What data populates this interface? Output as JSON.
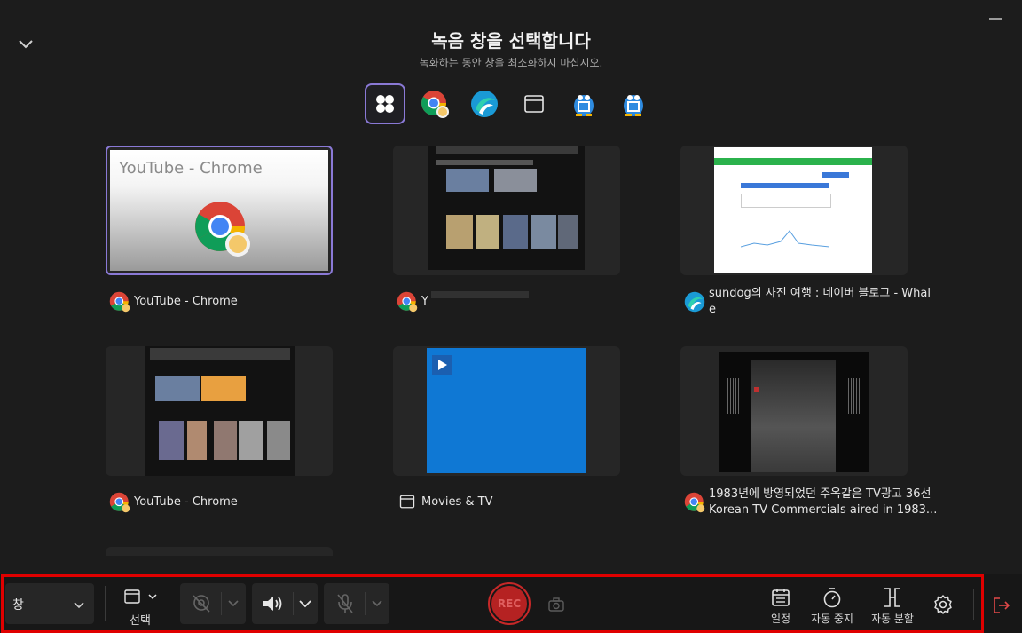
{
  "header": {
    "title": "녹음 창을 선택합니다",
    "subtitle": "녹화하는 동안 창을 최소화하지 마십시오."
  },
  "filters": [
    {
      "name": "all-windows-icon",
      "selected": true
    },
    {
      "name": "chrome-icon",
      "selected": false
    },
    {
      "name": "whale-icon",
      "selected": false
    },
    {
      "name": "window-icon",
      "selected": false
    },
    {
      "name": "capture-app-icon",
      "selected": false
    },
    {
      "name": "capture-app-icon",
      "selected": false
    }
  ],
  "windows": [
    {
      "thumb_title": "YouTube - Chrome",
      "caption": "YouTube - Chrome",
      "icon": "chrome-icon",
      "selected": true
    },
    {
      "caption": "Y",
      "icon": "chrome-icon",
      "selected": false
    },
    {
      "caption": "sundog의 사진 여행 : 네이버 블로그 - Whale",
      "icon": "whale-icon",
      "selected": false
    },
    {
      "caption": "YouTube - Chrome",
      "icon": "chrome-icon",
      "selected": false
    },
    {
      "caption": "Movies & TV",
      "icon": "window-icon",
      "selected": false
    },
    {
      "caption": "1983년에 방영되었던 주옥같은 TV광고 36선 Korean TV Commercials aired in 1983...",
      "icon": "chrome-icon",
      "selected": false
    }
  ],
  "toolbar": {
    "mode_value": "창",
    "select_label": "선택",
    "rec_label": "REC",
    "schedule_label": "일정",
    "auto_stop_label": "자동 중지",
    "auto_split_label": "자동 분할"
  },
  "colors": {
    "accent": "#8a79d6",
    "rec": "#c62828",
    "highlight_frame": "#e00000",
    "exit": "#e04848"
  }
}
